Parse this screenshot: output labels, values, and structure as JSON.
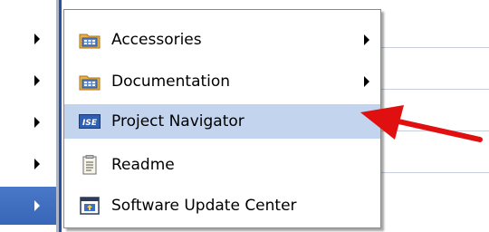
{
  "menu": {
    "items": [
      {
        "label": "Accessories",
        "icon": "program-group-folder-icon",
        "has_submenu": true
      },
      {
        "label": "Documentation",
        "icon": "program-group-folder-icon",
        "has_submenu": true
      },
      {
        "label": "Project Navigator",
        "icon": "ise-app-icon",
        "has_submenu": false,
        "highlighted": true,
        "icon_text": "ISE"
      },
      {
        "label": "Readme",
        "icon": "text-document-icon",
        "has_submenu": false
      },
      {
        "label": "Software Update Center",
        "icon": "update-window-icon",
        "has_submenu": false
      }
    ]
  },
  "colors": {
    "highlight": "#c3d4ee",
    "selected_parent": "#3866b8",
    "annotation_arrow": "#e01010"
  }
}
